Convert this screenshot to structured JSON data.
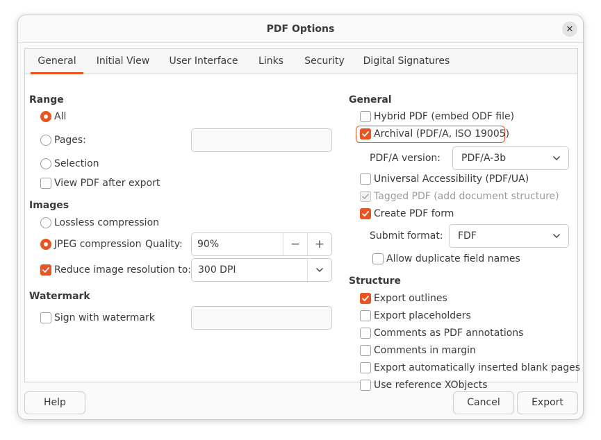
{
  "window": {
    "title": "PDF Options"
  },
  "tabs": [
    {
      "label": "General",
      "active": true
    },
    {
      "label": "Initial View",
      "active": false
    },
    {
      "label": "User Interface",
      "active": false
    },
    {
      "label": "Links",
      "active": false
    },
    {
      "label": "Security",
      "active": false
    },
    {
      "label": "Digital Signatures",
      "active": false
    }
  ],
  "range": {
    "title": "Range",
    "all_label": "All",
    "pages_label": "Pages:",
    "pages_value": "",
    "selection_label": "Selection",
    "selected": "All",
    "view_after_export_label": "View PDF after export",
    "view_after_export_checked": false
  },
  "images": {
    "title": "Images",
    "lossless_label": "Lossless compression",
    "jpeg_label": "JPEG compression",
    "quality_label": "Quality:",
    "quality_value": "90%",
    "selected": "JPEG compression",
    "reduce_label": "Reduce image resolution to:",
    "reduce_checked": true,
    "resolution_value": "300 DPI"
  },
  "watermark": {
    "title": "Watermark",
    "sign_label": "Sign with watermark",
    "sign_checked": false,
    "text_value": ""
  },
  "general": {
    "title": "General",
    "hybrid_label": "Hybrid PDF (embed ODF file)",
    "hybrid_checked": false,
    "archival_label": "Archival (PDF/A, ISO 19005)",
    "archival_checked": true,
    "pdfa_version_label": "PDF/A version:",
    "pdfa_version_value": "PDF/A-3b",
    "ua_label": "Universal Accessibility (PDF/UA)",
    "ua_checked": false,
    "tagged_label": "Tagged PDF (add document structure)",
    "tagged_checked": true,
    "form_label": "Create PDF form",
    "form_checked": true,
    "submit_format_label": "Submit format:",
    "submit_format_value": "FDF",
    "duplicate_label": "Allow duplicate field names",
    "duplicate_checked": false
  },
  "structure": {
    "title": "Structure",
    "outlines_label": "Export outlines",
    "outlines_checked": true,
    "placeholders_label": "Export placeholders",
    "comments_annot_label": "Comments as PDF annotations",
    "comments_margin_label": "Comments in margin",
    "blank_pages_label": "Export automatically inserted blank pages",
    "xobjects_label": "Use reference XObjects"
  },
  "footer": {
    "help_label": "Help",
    "cancel_label": "Cancel",
    "export_label": "Export"
  },
  "colors": {
    "accent": "#e95420"
  }
}
